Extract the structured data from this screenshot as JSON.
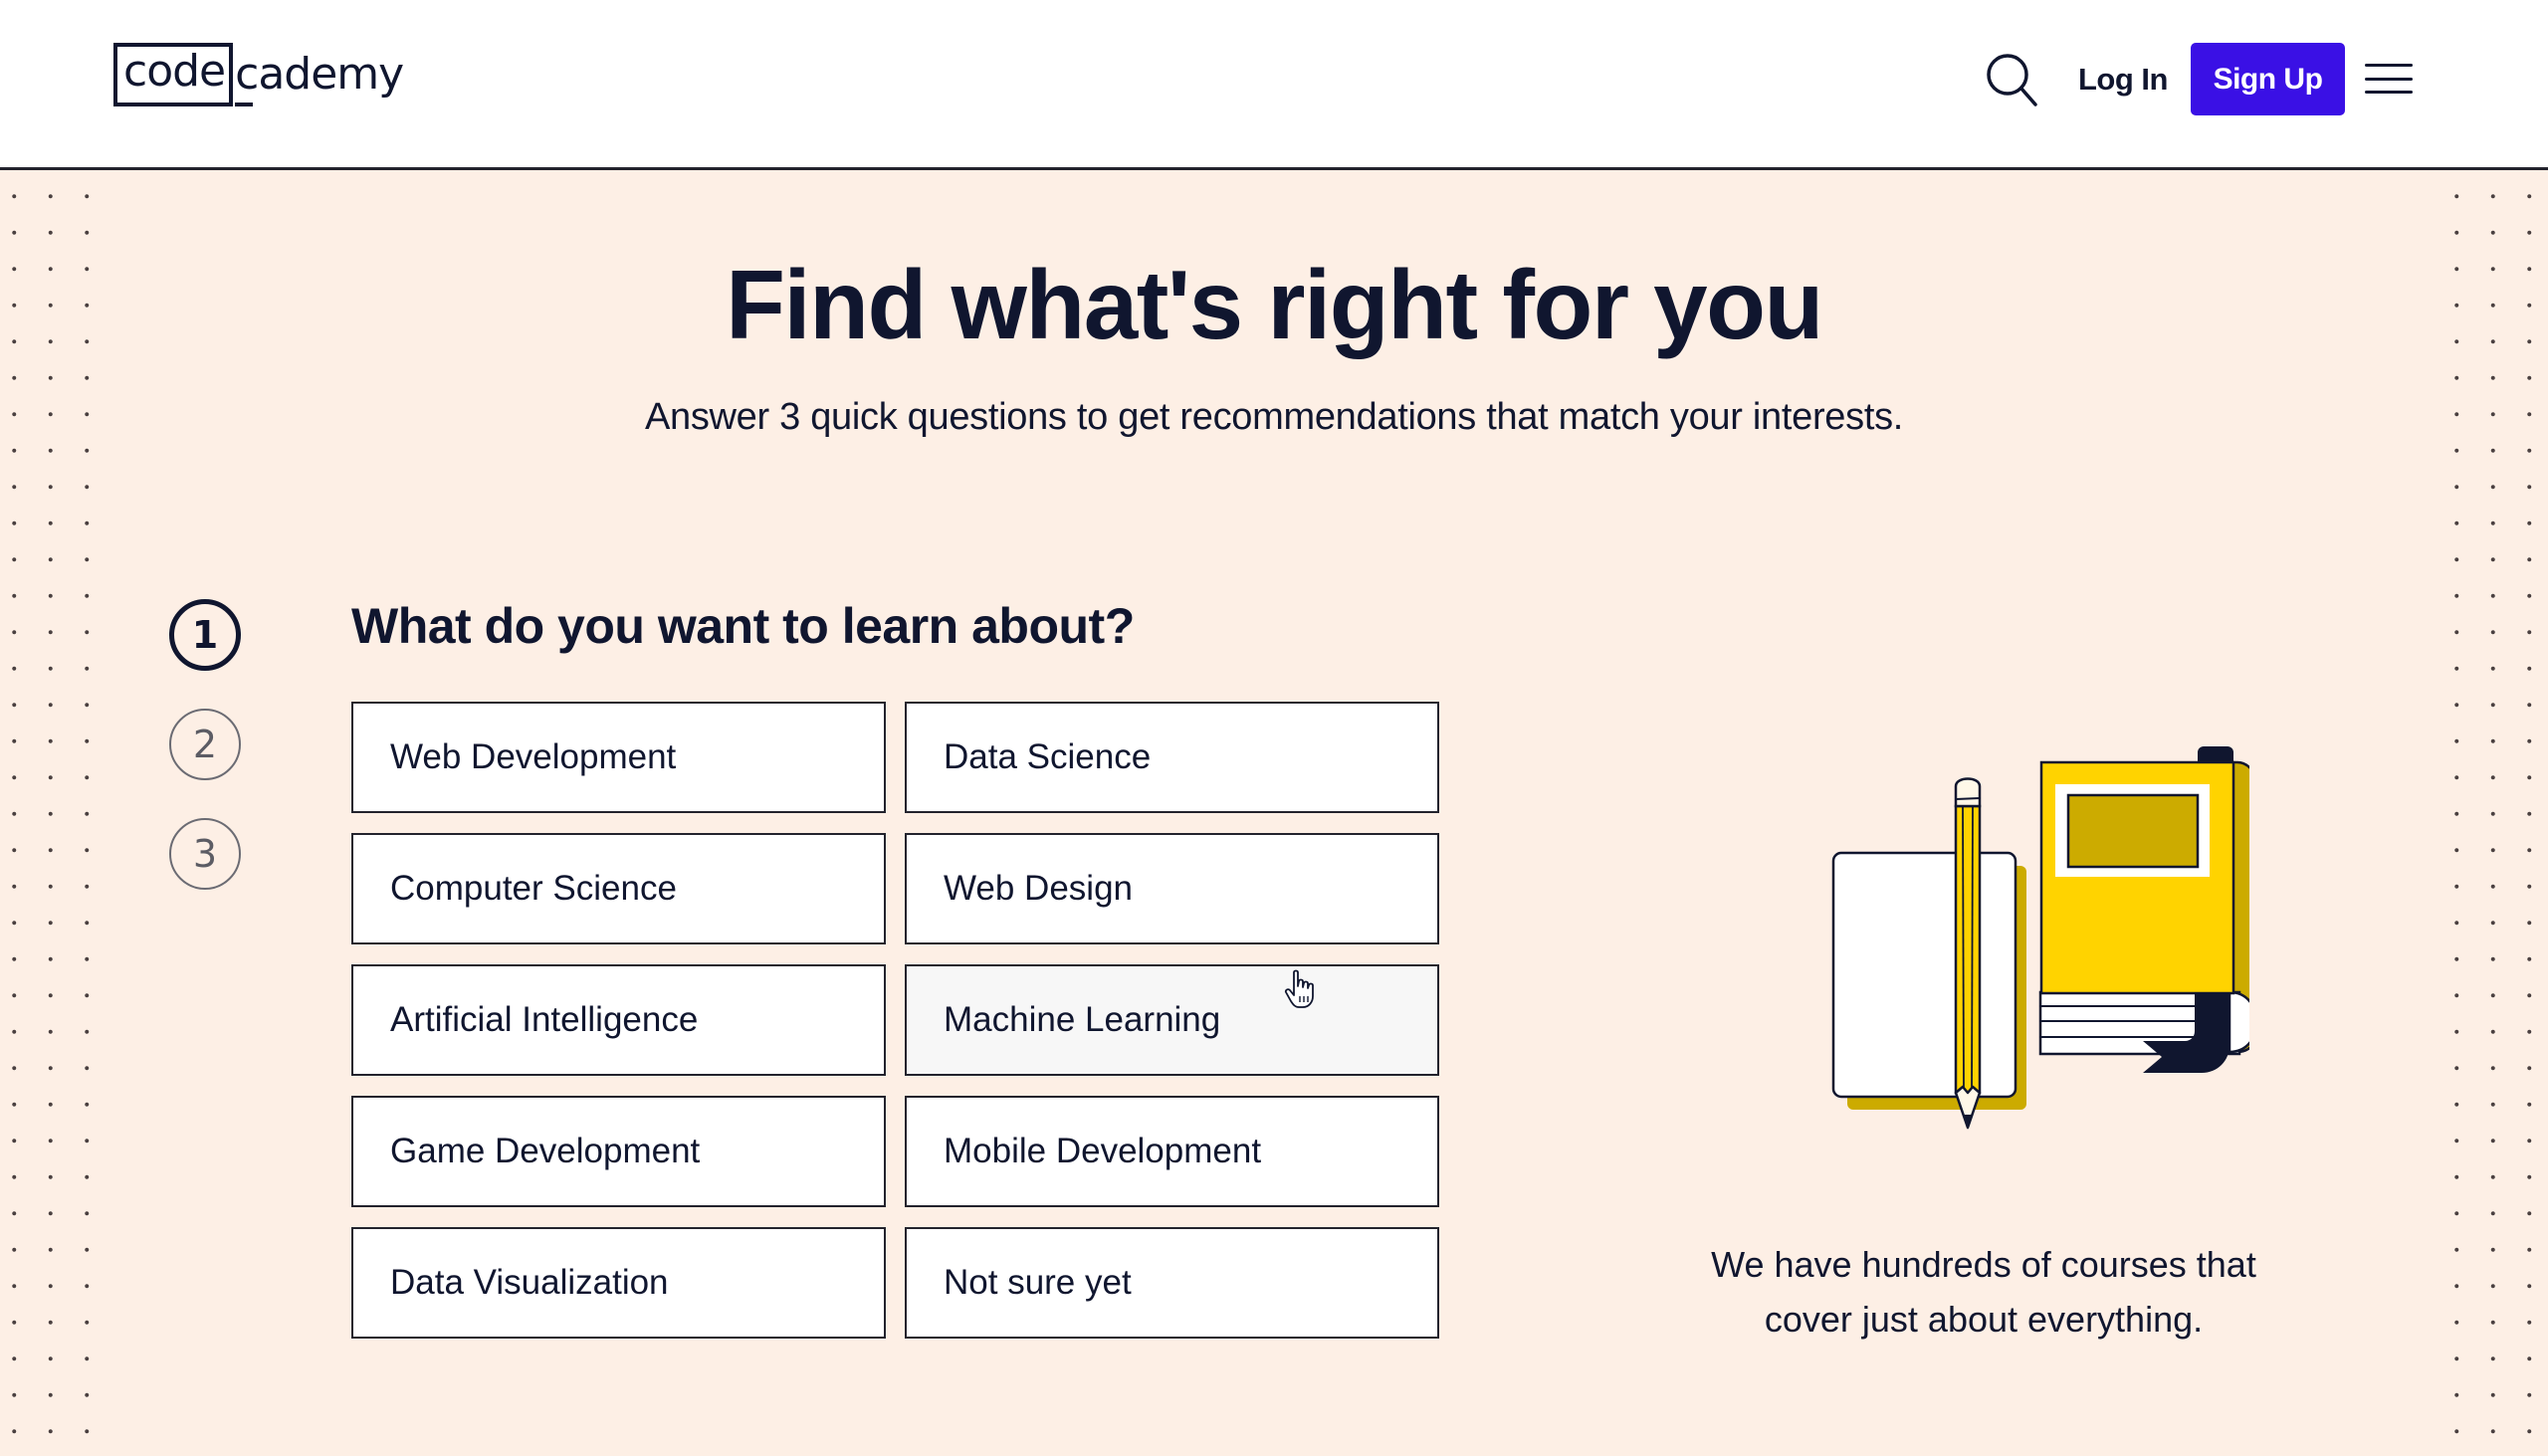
{
  "header": {
    "logo": {
      "boxed": "code",
      "rest": "cademy"
    },
    "search_label": "Search",
    "login_label": "Log In",
    "signup_label": "Sign Up",
    "menu_label": "Menu"
  },
  "hero": {
    "title": "Find what's right for you",
    "subtitle": "Answer 3 quick questions to get recommendations that match your interests."
  },
  "steps": [
    {
      "number": "1",
      "active": true
    },
    {
      "number": "2",
      "active": false
    },
    {
      "number": "3",
      "active": false
    }
  ],
  "question": {
    "title": "What do you want to learn about?",
    "options": [
      "Web Development",
      "Data Science",
      "Computer Science",
      "Web Design",
      "Artificial Intelligence",
      "Machine Learning",
      "Game Development",
      "Mobile Development",
      "Data Visualization",
      "Not sure yet"
    ],
    "hovered_option": "Machine Learning"
  },
  "aside": {
    "illustration": "notebook-pencil-book-illustration",
    "caption_line1": "We have hundreds of courses that",
    "caption_line2": "cover just about everything."
  },
  "colors": {
    "brand_primary": "#3a10e5",
    "text_dark": "#10162f",
    "background_cream": "#fdefe5",
    "illustration_yellow": "#ffd300",
    "illustration_yellow_shade": "#ccab00"
  }
}
